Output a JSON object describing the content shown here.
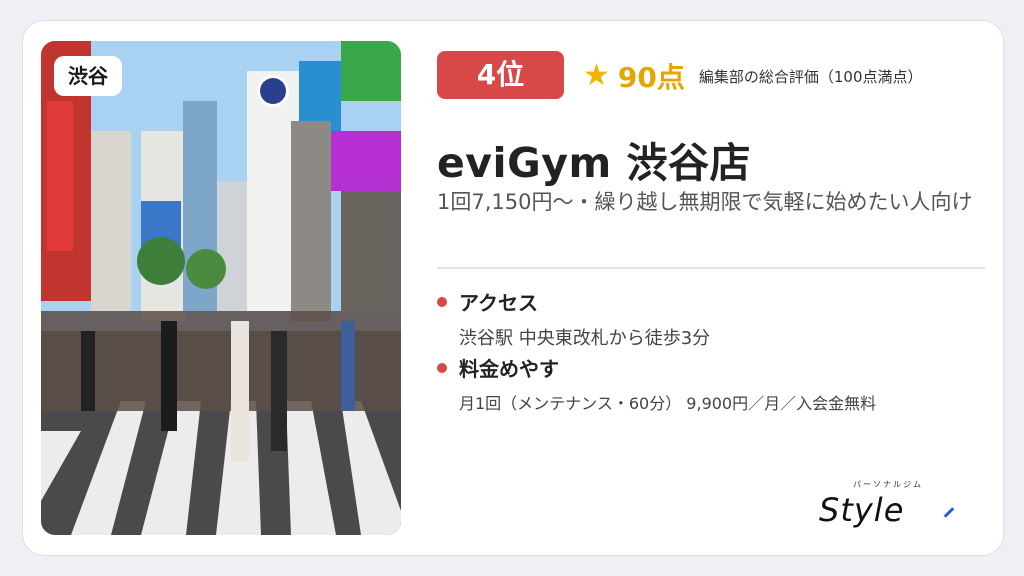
{
  "card": {
    "location_badge": "渋谷",
    "rank_label": "4位",
    "score_star": "★",
    "score_value": "90点",
    "score_note": "編集部の総合評価（100点満点）",
    "title": "eviGym 渋谷店",
    "subtitle": "1回7,150円〜・繰り越し無期限で気軽に始めたい人向け",
    "access": {
      "label": "アクセス",
      "value": "渋谷駅 中央東改札から徒歩3分"
    },
    "price": {
      "label": "料金めやす",
      "value": "月1回（メンテナンス・60分） 9,900円／月／入会金無料"
    },
    "logo": {
      "kana": "パーソナルジム",
      "wordmark": "Style"
    }
  },
  "colors": {
    "accent_red": "#d94848",
    "star_gold": "#f2b400",
    "logo_blue": "#2b5fd9"
  },
  "icons": {
    "photo": "shibuya-crossing-photo",
    "bullet": "red-dot-icon"
  }
}
